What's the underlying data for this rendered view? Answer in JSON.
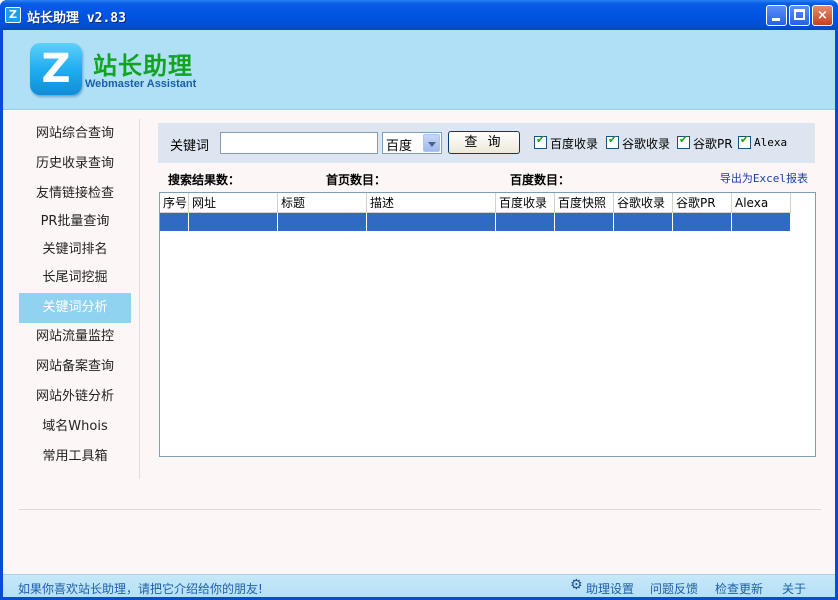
{
  "window": {
    "title": "站长助理 v2.83",
    "icon_letter": "Z",
    "controls": {
      "minimize": "minimize-icon",
      "maximize": "maximize-icon",
      "close": "×"
    }
  },
  "banner": {
    "logo_letter": "Z",
    "brand_cn": "站长助理",
    "brand_en": "Webmaster Assistant"
  },
  "sidebar": {
    "items": [
      {
        "label": "网站综合查询"
      },
      {
        "label": "历史收录查询"
      },
      {
        "label": "友情链接检查"
      },
      {
        "label": "PR批量查询"
      },
      {
        "label": "关键词排名"
      },
      {
        "label": "长尾词挖掘"
      },
      {
        "label": "关键词分析",
        "active": true
      },
      {
        "label": "网站流量监控"
      },
      {
        "label": "网站备案查询"
      },
      {
        "label": "网站外链分析"
      },
      {
        "label": "域名Whois"
      },
      {
        "label": "常用工具箱"
      }
    ]
  },
  "toolbar": {
    "keyword_label": "关键词",
    "keyword_value": "",
    "engine_selected": "百度",
    "query_button": "查 询",
    "checkboxes": [
      {
        "label": "百度收录",
        "checked": true
      },
      {
        "label": "谷歌收录",
        "checked": true
      },
      {
        "label": "谷歌PR",
        "checked": true
      },
      {
        "label": "Alexa",
        "checked": true
      }
    ],
    "tick": "✔"
  },
  "stats": {
    "results_label": "搜索结果数：",
    "homepage_label": "首页数目：",
    "baidu_label": "百度数目：",
    "export_link": "导出为Excel报表"
  },
  "table": {
    "columns": [
      "序号",
      "网址",
      "标题",
      "描述",
      "百度收录",
      "百度快照",
      "谷歌收录",
      "谷歌PR",
      "Alexa"
    ],
    "rows": [
      [
        "",
        "",
        "",
        "",
        "",
        "",
        "",
        "",
        ""
      ]
    ]
  },
  "statusbar": {
    "promo": "如果你喜欢站长助理，请把它介绍给你的朋友!",
    "settings": "助理设置",
    "feedback": "问题反馈",
    "update": "检查更新",
    "about": "关于",
    "settings_icon": "gear-icon"
  },
  "colors": {
    "titlebar": "#0054e3",
    "banner": "#b0e0f6",
    "active_nav": "#8fd3f0",
    "selection": "#316ac5",
    "brand_green": "#12a321",
    "link_blue": "#1f5fa8"
  }
}
